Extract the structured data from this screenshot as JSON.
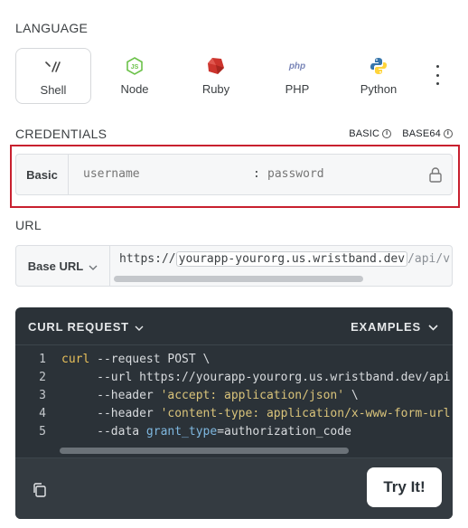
{
  "language": {
    "title": "LANGUAGE",
    "options": [
      {
        "label": "Shell",
        "icon": "shell-icon",
        "active": true
      },
      {
        "label": "Node",
        "icon": "nodejs-icon",
        "active": false
      },
      {
        "label": "Ruby",
        "icon": "ruby-icon",
        "active": false
      },
      {
        "label": "PHP",
        "icon": "php-icon",
        "active": false
      },
      {
        "label": "Python",
        "icon": "python-icon",
        "active": false
      }
    ],
    "icon_text": {
      "php": "php"
    },
    "more_icon": "more-vertical-icon"
  },
  "credentials": {
    "title": "CREDENTIALS",
    "options": [
      {
        "label": "BASIC",
        "info": "i"
      },
      {
        "label": "BASE64",
        "info": "i"
      }
    ],
    "auth_label": "Basic",
    "username_placeholder": "username",
    "separator": ":",
    "password_placeholder": "password",
    "highlight_color": "#c8202f"
  },
  "url": {
    "title": "URL",
    "base_label": "Base URL",
    "prefix": "https://",
    "host": "yourapp-yourorg.us.wristband.dev",
    "path": "/api/v"
  },
  "code": {
    "header_label": "CURL REQUEST",
    "examples_label": "EXAMPLES",
    "lines": [
      {
        "n": "1",
        "parts": [
          [
            "kw",
            "curl"
          ],
          [
            "opt",
            " --request POST \\"
          ]
        ]
      },
      {
        "n": "2",
        "parts": [
          [
            "opt",
            "     --url https://yourapp-yourorg.us.wristband.dev/api"
          ]
        ]
      },
      {
        "n": "3",
        "parts": [
          [
            "opt",
            "     --header "
          ],
          [
            "str",
            "'accept: application/json'"
          ],
          [
            "opt",
            " \\"
          ]
        ]
      },
      {
        "n": "4",
        "parts": [
          [
            "opt",
            "     --header "
          ],
          [
            "str",
            "'content-type: application/x-www-form-url"
          ]
        ]
      },
      {
        "n": "5",
        "parts": [
          [
            "opt",
            "     --data "
          ],
          [
            "key",
            "grant_type"
          ],
          [
            "plain",
            "=authorization_code"
          ]
        ]
      }
    ],
    "try_label": "Try It!",
    "panel_color": "#2b3238"
  }
}
